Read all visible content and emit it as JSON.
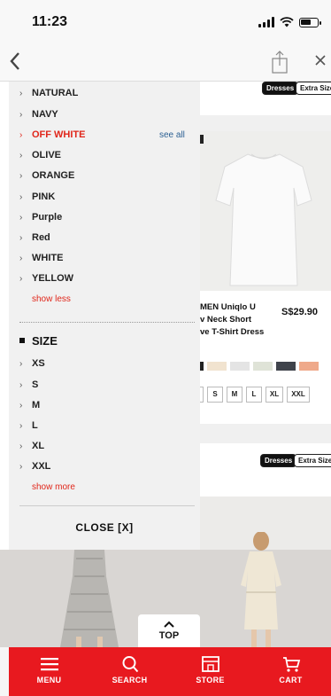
{
  "status_bar": {
    "time": "11:23"
  },
  "filter_panel": {
    "color_items": [
      {
        "label": "NATURAL"
      },
      {
        "label": "NAVY"
      },
      {
        "label": "OFF WHITE"
      },
      {
        "label": "OLIVE"
      },
      {
        "label": "ORANGE"
      },
      {
        "label": "PINK"
      },
      {
        "label": "Purple"
      },
      {
        "label": "Red"
      },
      {
        "label": "WHITE"
      },
      {
        "label": "YELLOW"
      }
    ],
    "see_all": "see all",
    "show_less": "show less",
    "size_header": "SIZE",
    "size_items": [
      {
        "label": "XS"
      },
      {
        "label": "S"
      },
      {
        "label": "M"
      },
      {
        "label": "L"
      },
      {
        "label": "XL"
      },
      {
        "label": "XXL"
      }
    ],
    "show_more": "show more",
    "close_label": "CLOSE [X]"
  },
  "products": {
    "tag_dresses": "Dresses",
    "tag_extra_size": "Extra Size",
    "product_name": "MEN Uniqlo U\nv Neck Short\nve T-Shirt Dress",
    "product_price": "S$29.90",
    "sizes": [
      "S",
      "M",
      "L",
      "XL",
      "XXL"
    ],
    "swatch_colors": [
      "#222222",
      "#f1e3cf",
      "#e4e4e4",
      "#dfe3d7",
      "#3f434b",
      "#efa98a"
    ]
  },
  "top_button": "TOP",
  "tab_bar": {
    "menu": "MENU",
    "search": "SEARCH",
    "store": "STORE",
    "cart": "CART"
  },
  "colors": {
    "brand_red": "#e8191f",
    "active_red": "#e0261a",
    "link_blue": "#2b5f92"
  }
}
